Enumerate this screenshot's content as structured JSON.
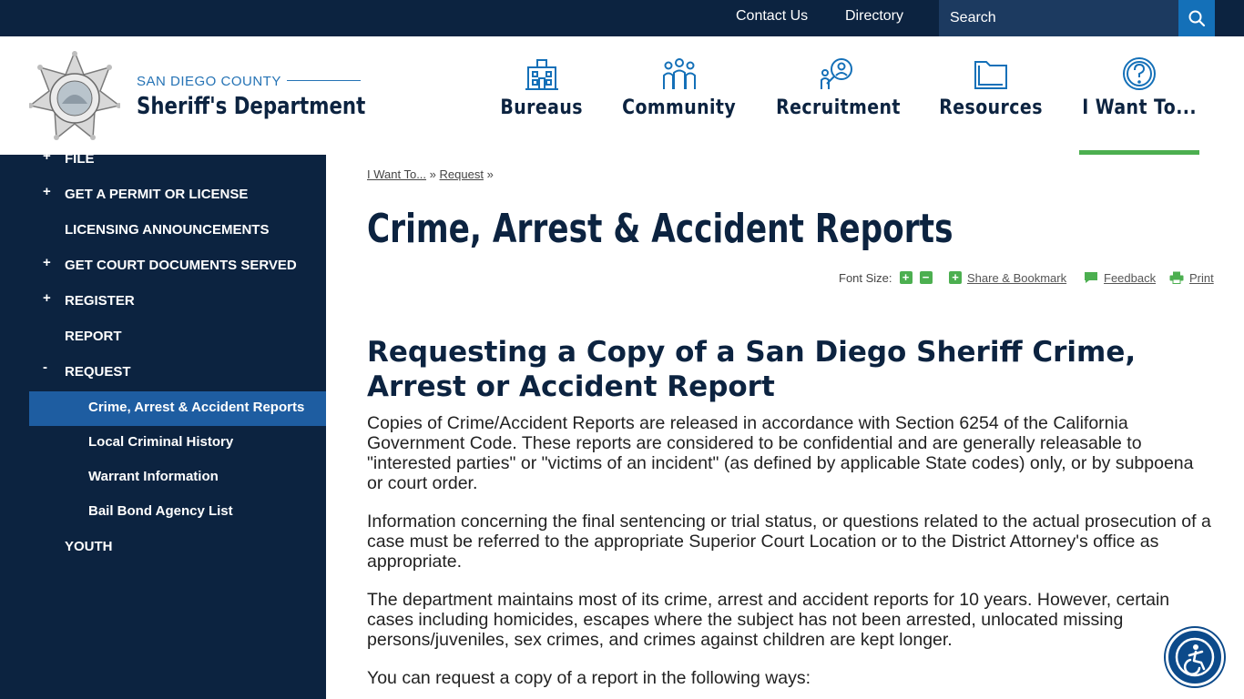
{
  "topbar": {
    "contact_us": "Contact Us",
    "directory": "Directory",
    "search_placeholder": "Search"
  },
  "logo": {
    "subtitle": "SAN DIEGO COUNTY",
    "title": "Sheriff's Department"
  },
  "nav": {
    "items": [
      {
        "label": "Bureaus",
        "icon": "building-icon"
      },
      {
        "label": "Community",
        "icon": "people-icon"
      },
      {
        "label": "Recruitment",
        "icon": "magnify-person-icon"
      },
      {
        "label": "Resources",
        "icon": "folder-icon"
      },
      {
        "label": "I Want To...",
        "icon": "question-icon"
      }
    ],
    "active": "I Want To..."
  },
  "sidebar": {
    "items": [
      {
        "label": "FILE",
        "expander": "+"
      },
      {
        "label": "GET A PERMIT OR LICENSE",
        "expander": "+"
      },
      {
        "label": "LICENSING ANNOUNCEMENTS",
        "expander": ""
      },
      {
        "label": "GET COURT DOCUMENTS SERVED",
        "expander": "+"
      },
      {
        "label": "REGISTER",
        "expander": "+"
      },
      {
        "label": "REPORT",
        "expander": ""
      },
      {
        "label": "REQUEST",
        "expander": "-"
      }
    ],
    "subitems": [
      {
        "label": "Crime, Arrest & Accident Reports"
      },
      {
        "label": "Local Criminal History"
      },
      {
        "label": "Warrant Information"
      },
      {
        "label": "Bail Bond Agency List"
      }
    ],
    "last_item": "YOUTH"
  },
  "breadcrumb": {
    "item1": "I Want To...",
    "item2": "Request",
    "separator": "»"
  },
  "page": {
    "title": "Crime, Arrest & Accident Reports"
  },
  "tools": {
    "font_size_label": "Font Size:",
    "font_plus": "+",
    "font_minus": "−",
    "share": "Share & Bookmark",
    "feedback": "Feedback",
    "print": "Print"
  },
  "content": {
    "heading": "Requesting a Copy of a San Diego Sheriff Crime, Arrest or Accident Report",
    "paragraphs": [
      "Copies of Crime/Accident Reports are released in accordance with Section 6254 of the California Government Code. These reports are considered to be confidential and are generally releasable to \"interested parties\" or \"victims of an incident\" (as defined by applicable State codes) only, or by subpoena or court order.",
      "Information concerning the final sentencing or trial status, or questions related to the actual prosecution of a case must be referred to the appropriate Superior Court Location or to the District Attorney's office as appropriate.",
      "The department maintains most of its crime, arrest and accident reports for 10 years. However, certain cases including homicides, escapes where the subject has not been arrested, unlocated missing persons/juveniles, sex crimes, and crimes against children are kept longer.",
      "You can request a copy of a report in the following ways:"
    ]
  },
  "colors": {
    "navy": "#0c2340",
    "accent_blue": "#1470b8",
    "green": "#4caf50",
    "sidebar_active": "#1e5da1"
  }
}
